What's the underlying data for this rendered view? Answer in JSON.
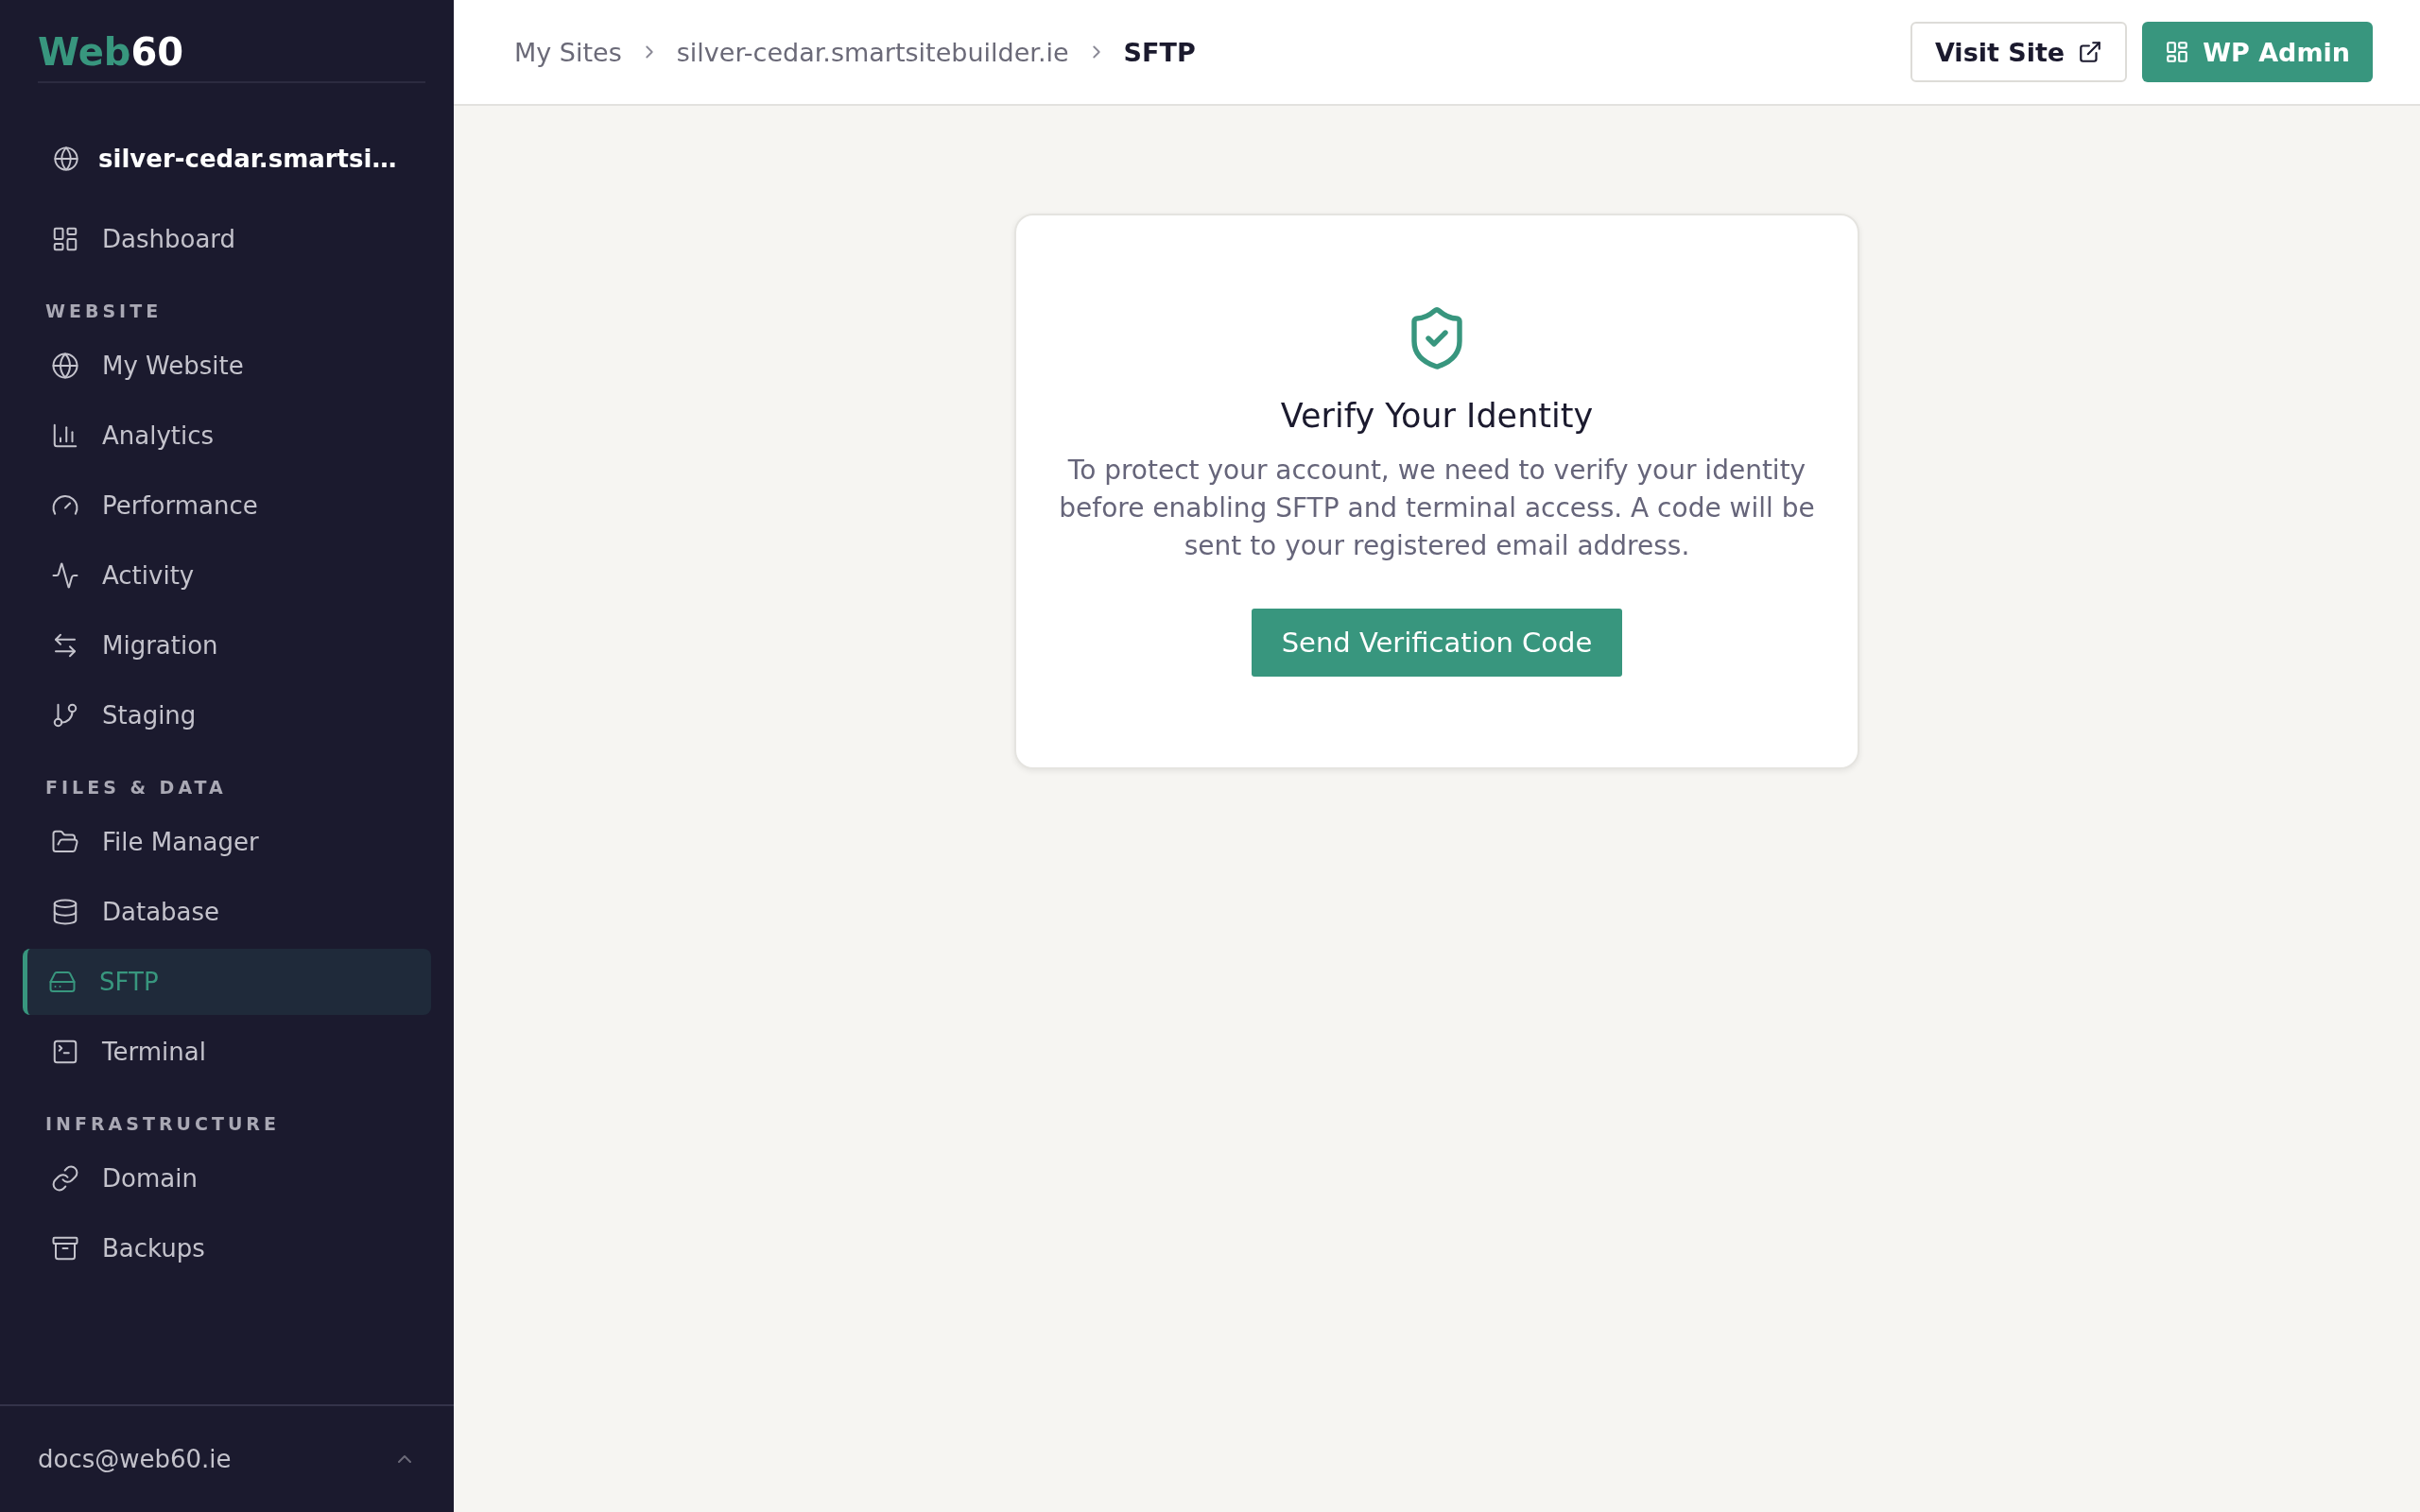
{
  "logo": {
    "accent": "Web",
    "rest": "60"
  },
  "sidebar": {
    "site": "silver-cedar.smartsi…",
    "top_items": [
      {
        "label": "Dashboard",
        "selected": false
      }
    ],
    "sections": [
      {
        "title": "WEBSITE",
        "items": [
          {
            "label": "My Website",
            "selected": false
          },
          {
            "label": "Analytics",
            "selected": false
          },
          {
            "label": "Performance",
            "selected": false
          },
          {
            "label": "Activity",
            "selected": false
          },
          {
            "label": "Migration",
            "selected": false
          },
          {
            "label": "Staging",
            "selected": false
          }
        ]
      },
      {
        "title": "FILES & DATA",
        "items": [
          {
            "label": "File Manager",
            "selected": false
          },
          {
            "label": "Database",
            "selected": false
          },
          {
            "label": "SFTP",
            "selected": true
          },
          {
            "label": "Terminal",
            "selected": false
          }
        ]
      },
      {
        "title": "INFRASTRUCTURE",
        "items": [
          {
            "label": "Domain",
            "selected": false
          },
          {
            "label": "Backups",
            "selected": false
          }
        ]
      }
    ],
    "account": "docs@web60.ie"
  },
  "breadcrumb": [
    "My Sites",
    "silver-cedar.smartsitebuilder.ie",
    "SFTP"
  ],
  "header_buttons": {
    "visit": "Visit Site",
    "admin": "WP Admin"
  },
  "card": {
    "title": "Verify Your Identity",
    "text": "To protect your account, we need to verify your identity before enabling SFTP and terminal access. A code will be sent to your registered email address.",
    "button": "Send Verification Code"
  }
}
